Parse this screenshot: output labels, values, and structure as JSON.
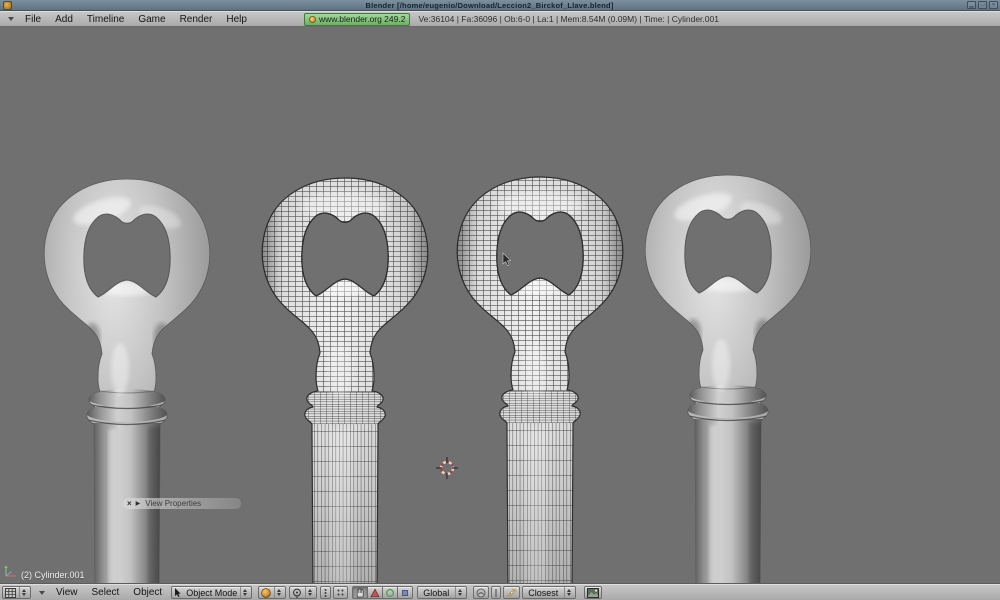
{
  "window": {
    "title": "Blender [/home/eugenio/Download/Leccion2_Birckof_Llave.blend]",
    "controls": {
      "minimize": "▁",
      "maximize": "□",
      "close": "×"
    }
  },
  "top_header": {
    "menus": [
      "File",
      "Add",
      "Timeline",
      "Game",
      "Render",
      "Help"
    ],
    "badge": "www.blender.org 249.2",
    "stats": "Ve:36104 | Fa:36096 | Ob:6-0 | La:1 | Mem:8.54M (0.09M) | Time: | Cylinder.001"
  },
  "viewport": {
    "floating_panel": {
      "close": "×",
      "expand": "▶",
      "title": "View Properties"
    },
    "object_label": "(2) Cylinder.001"
  },
  "bottom_header": {
    "menus": [
      "View",
      "Select",
      "Object"
    ],
    "mode_dropdown": "Object Mode",
    "orientation_dropdown": "Global",
    "snap_dropdown": "Closest"
  },
  "colors": {
    "titlebar_blue": "#6b7f8d",
    "header_gray": "#b8b8b8",
    "viewport_gray": "#707070",
    "badge_green": "#86c486",
    "badge_dot_orange": "#e8a33d",
    "draw_type_sphere": "#e8a33d",
    "manipulator_translate_red": "#c05555",
    "manipulator_rotate_green": "#58a058",
    "manipulator_scale_blue": "#7886b8",
    "cursor3d_red": "#9a4b4b"
  }
}
